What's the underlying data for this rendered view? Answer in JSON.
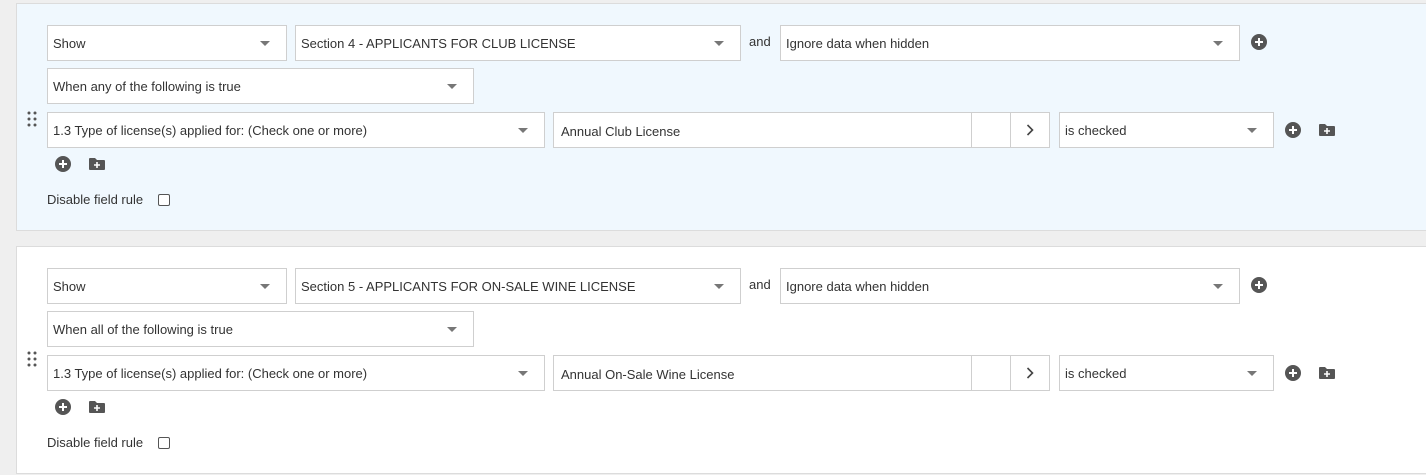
{
  "rules": [
    {
      "action": "Show",
      "target": "Section 4 - APPLICANTS FOR CLUB LICENSE",
      "connector": "and",
      "hidden_mode": "Ignore data when hidden",
      "logic": "When any of the following is true",
      "condition": {
        "field": "1.3 Type of license(s) applied for: (Check one or more)",
        "value": "Annual Club License",
        "operator": "is checked"
      },
      "disable_label": "Disable field rule"
    },
    {
      "action": "Show",
      "target": "Section 5 - APPLICANTS FOR ON-SALE WINE LICENSE",
      "connector": "and",
      "hidden_mode": "Ignore data when hidden",
      "logic": "When all of the following is true",
      "condition": {
        "field": "1.3 Type of license(s) applied for: (Check one or more)",
        "value": "Annual On-Sale Wine License",
        "operator": "is checked"
      },
      "disable_label": "Disable field rule"
    }
  ],
  "icons": {
    "grip": "drag-handle-icon",
    "plus": "add-circle-icon",
    "folder": "add-group-folder-icon",
    "caret": "chevron-down-icon",
    "next": "chevron-right-icon"
  },
  "colors": {
    "active_bg": "#f0f8fe",
    "plain_bg": "#ffffff",
    "icon": "#555555"
  }
}
